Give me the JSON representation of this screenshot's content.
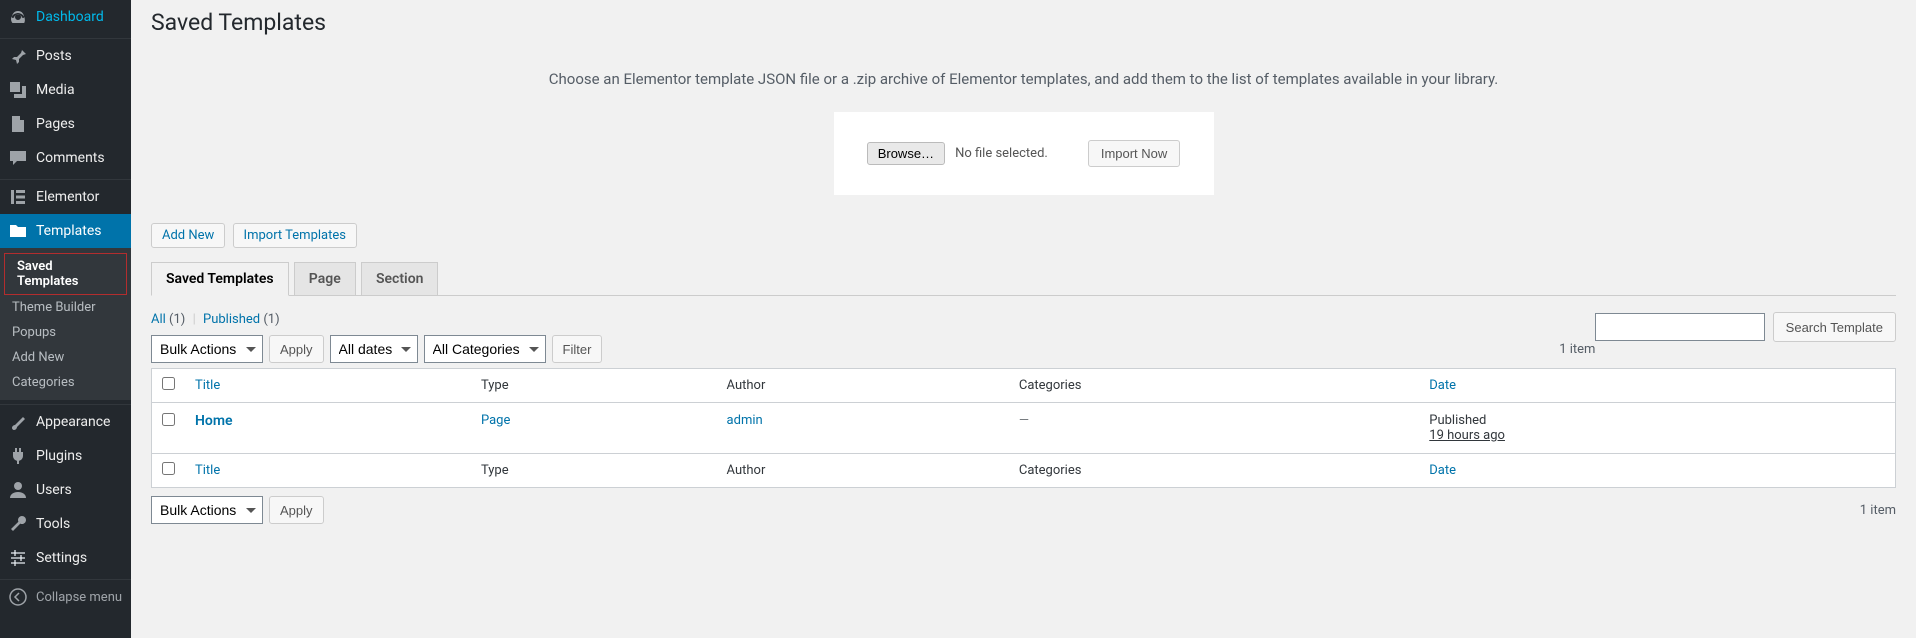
{
  "sidebar": {
    "items": [
      {
        "key": "dashboard",
        "label": "Dashboard"
      },
      {
        "key": "posts",
        "label": "Posts"
      },
      {
        "key": "media",
        "label": "Media"
      },
      {
        "key": "pages",
        "label": "Pages"
      },
      {
        "key": "comments",
        "label": "Comments"
      },
      {
        "key": "elementor",
        "label": "Elementor"
      },
      {
        "key": "templates",
        "label": "Templates"
      },
      {
        "key": "appearance",
        "label": "Appearance"
      },
      {
        "key": "plugins",
        "label": "Plugins"
      },
      {
        "key": "users",
        "label": "Users"
      },
      {
        "key": "tools",
        "label": "Tools"
      },
      {
        "key": "settings",
        "label": "Settings"
      },
      {
        "key": "collapse",
        "label": "Collapse menu"
      }
    ],
    "sub_templates": [
      {
        "key": "saved-templates",
        "label": "Saved Templates"
      },
      {
        "key": "theme-builder",
        "label": "Theme Builder"
      },
      {
        "key": "popups",
        "label": "Popups"
      },
      {
        "key": "add-new",
        "label": "Add New"
      },
      {
        "key": "categories",
        "label": "Categories"
      }
    ]
  },
  "page": {
    "title": "Saved Templates",
    "intro": "Choose an Elementor template JSON file or a .zip archive of Elementor templates, and add them to the list of templates available in your library.",
    "browse_btn": "Browse…",
    "no_file": "No file selected.",
    "import_now": "Import Now",
    "add_new": "Add New",
    "import_templates": "Import Templates",
    "tabs": [
      {
        "key": "saved",
        "label": "Saved Templates"
      },
      {
        "key": "page",
        "label": "Page"
      },
      {
        "key": "section",
        "label": "Section"
      }
    ],
    "subsub": {
      "all_label": "All",
      "all_count": "(1)",
      "published_label": "Published",
      "published_count": "(1)"
    },
    "search_btn": "Search Template",
    "bulk_actions": "Bulk Actions",
    "apply": "Apply",
    "all_dates": "All dates",
    "all_categories": "All Categories",
    "filter": "Filter",
    "item_count": "1 item",
    "columns": {
      "title": "Title",
      "type": "Type",
      "author": "Author",
      "categories": "Categories",
      "date": "Date"
    },
    "rows": [
      {
        "title": "Home",
        "type": "Page",
        "author": "admin",
        "categories": "—",
        "date_status": "Published",
        "date_ago": "19 hours ago"
      }
    ]
  }
}
